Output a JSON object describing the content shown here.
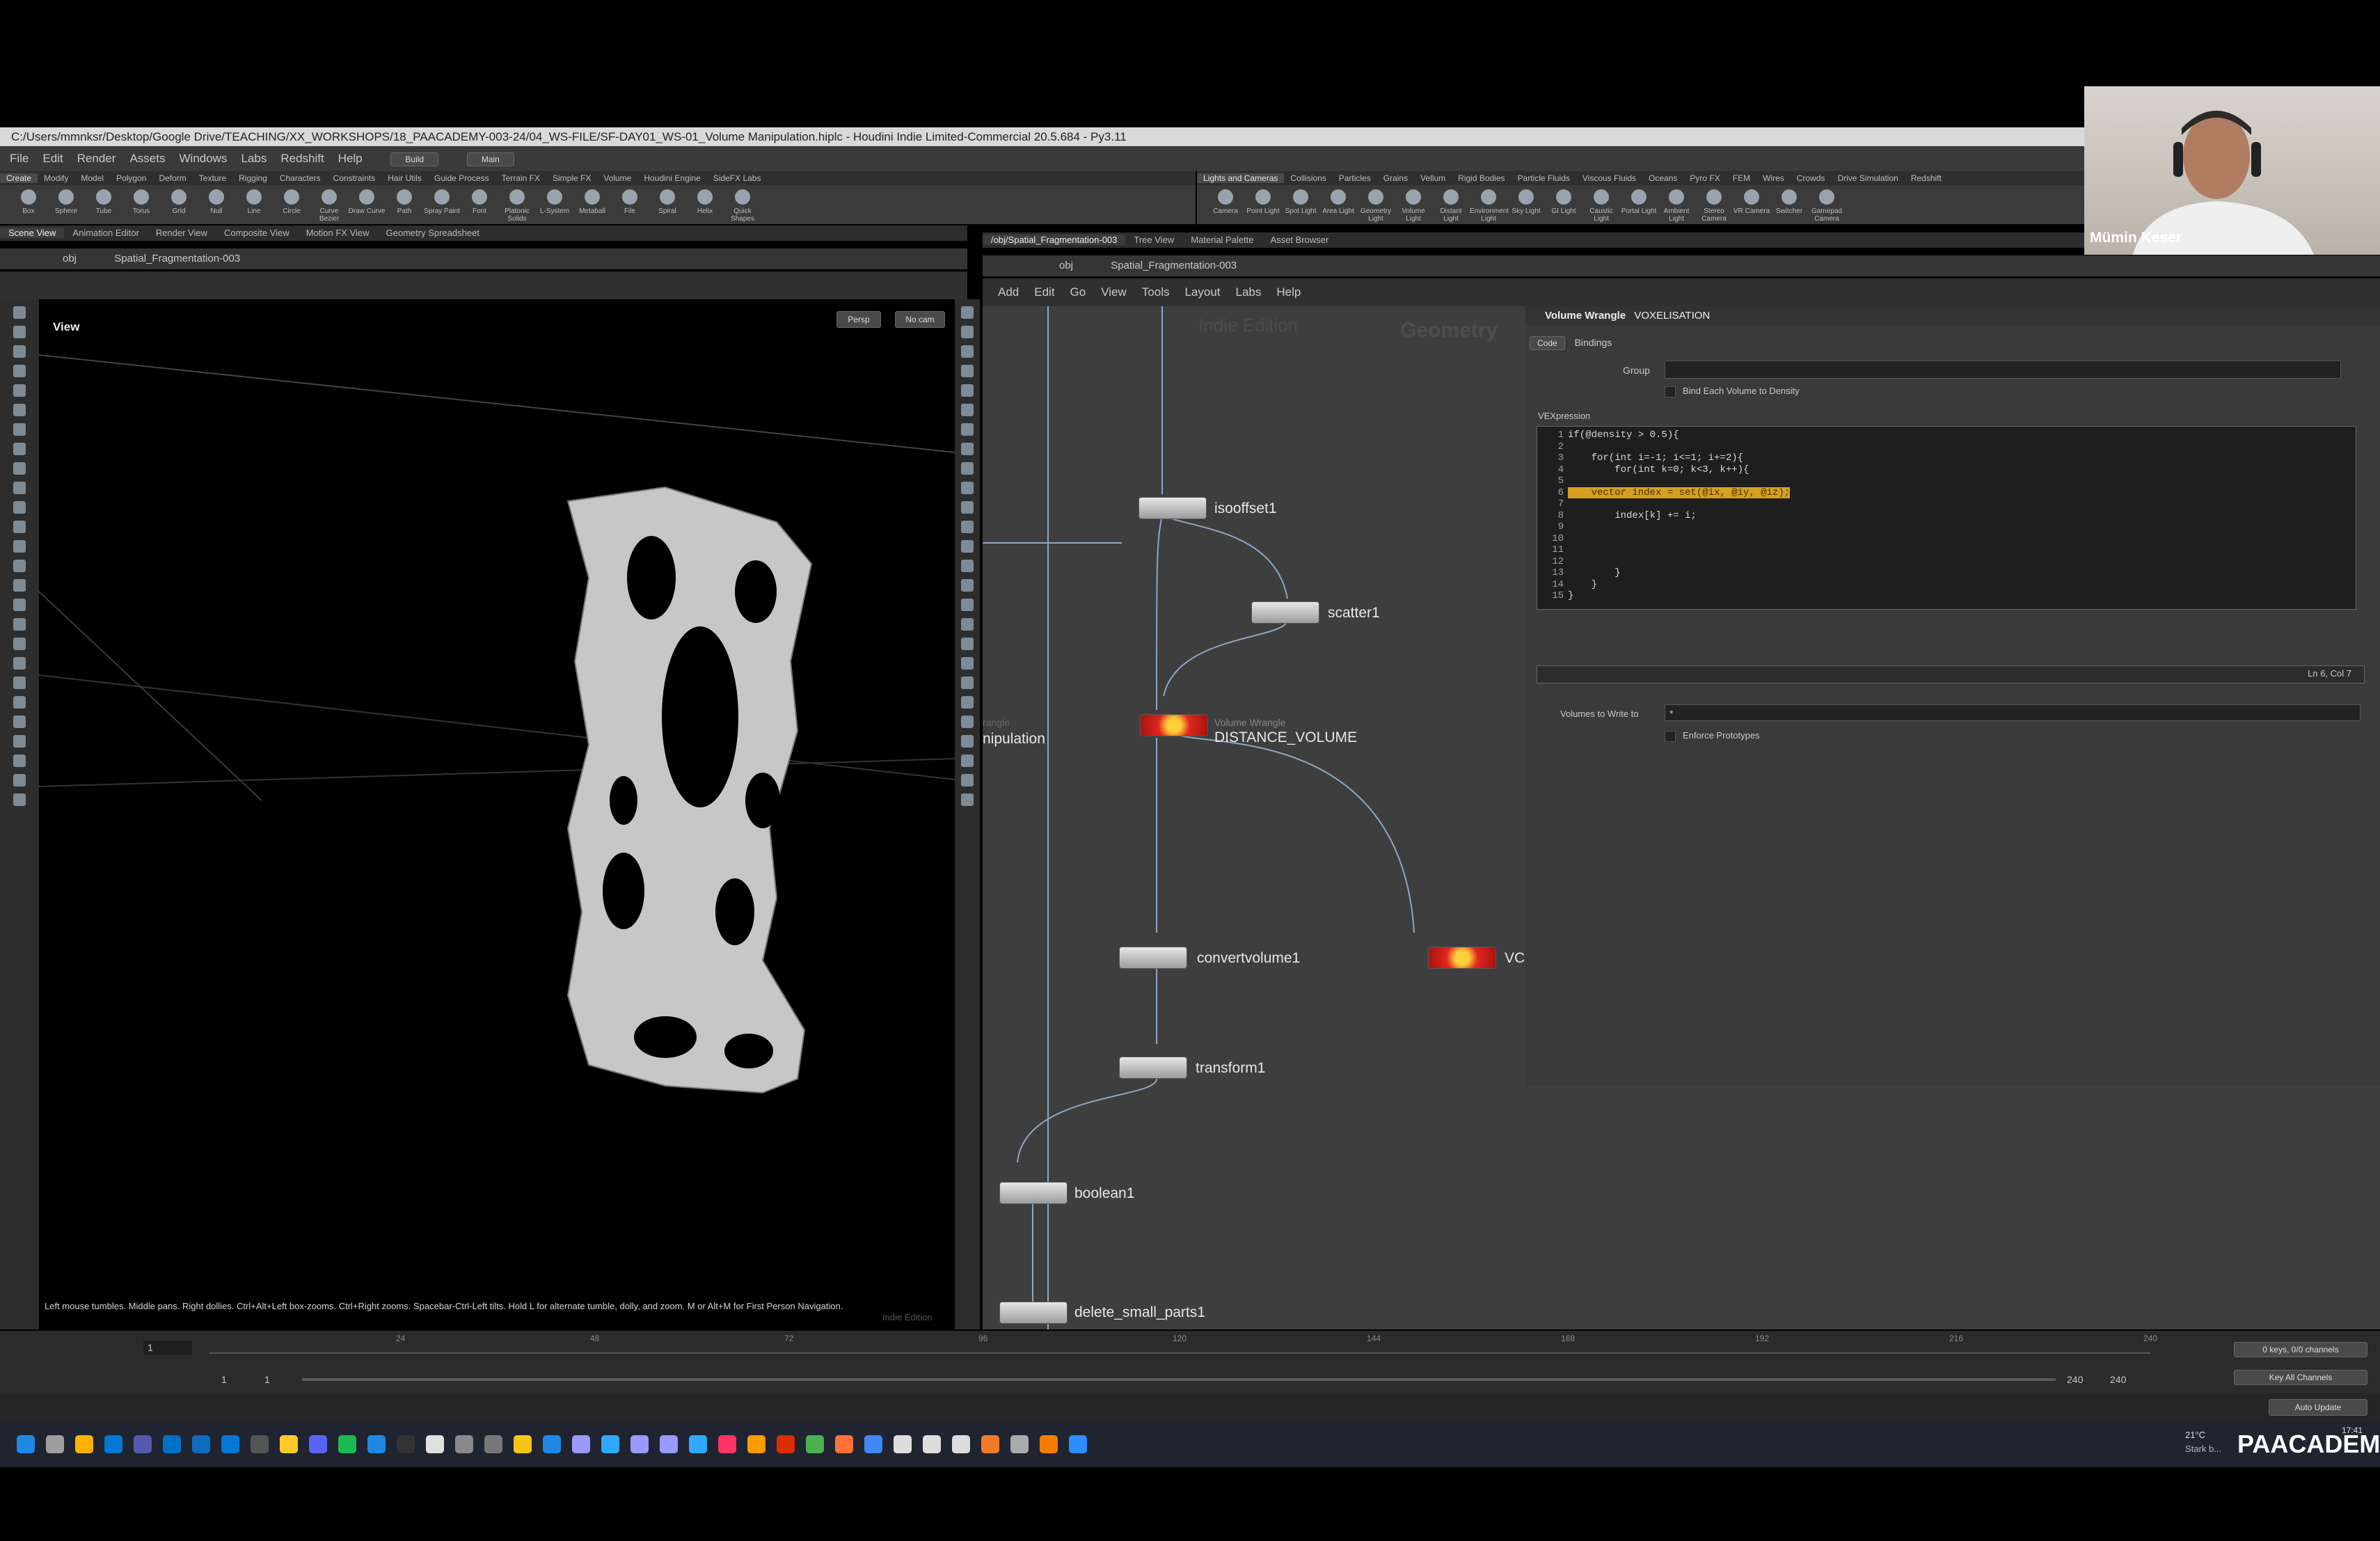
{
  "window": {
    "title": "C:/Users/mmnksr/Desktop/Google Drive/TEACHING/XX_WORKSHOPS/18_PAACADEMY-003-24/04_WS-FILE/SF-DAY01_WS-01_Volume Manipulation.hiplc - Houdini Indie Limited-Commercial 20.5.684 - Py3.11"
  },
  "menu": [
    "File",
    "Edit",
    "Render",
    "Assets",
    "Windows",
    "Labs",
    "Redshift",
    "Help"
  ],
  "desktops": {
    "build": "Build",
    "main": "Main"
  },
  "shelf_left": {
    "tabs": [
      "Create",
      "Modify",
      "Model",
      "Polygon",
      "Deform",
      "Texture",
      "Rigging",
      "Characters",
      "Constraints",
      "Hair Utils",
      "Guide Process",
      "Terrain FX",
      "Simple FX",
      "Volume",
      "Houdini Engine",
      "SideFX Labs"
    ],
    "tools": [
      "Box",
      "Sphere",
      "Tube",
      "Torus",
      "Grid",
      "Null",
      "Line",
      "Circle",
      "Curve Bezier",
      "Draw Curve",
      "Path",
      "Spray Paint",
      "Font",
      "Platonic Solids",
      "L-System",
      "Metaball",
      "File",
      "Spiral",
      "Helix",
      "Quick Shapes"
    ]
  },
  "shelf_right": {
    "tabs": [
      "Lights and Cameras",
      "Collisions",
      "Particles",
      "Grains",
      "Vellum",
      "Rigid Bodies",
      "Particle Fluids",
      "Viscous Fluids",
      "Oceans",
      "Pyro FX",
      "FEM",
      "Wires",
      "Crowds",
      "Drive Simulation",
      "Redshift"
    ],
    "tools": [
      "Camera",
      "Point Light",
      "Spot Light",
      "Area Light",
      "Geometry Light",
      "Volume Light",
      "Distant Light",
      "Environment Light",
      "Sky Light",
      "GI Light",
      "Caustic Light",
      "Portal Light",
      "Ambient Light",
      "Stereo Camera",
      "VR Camera",
      "Switcher",
      "Gamepad Camera"
    ]
  },
  "left_pane": {
    "tabs": [
      "Scene View",
      "Animation Editor",
      "Render View",
      "Composite View",
      "Motion FX View",
      "Geometry Spreadsheet"
    ],
    "path": {
      "context": "obj",
      "node": "Spatial_Fragmentation-003"
    },
    "view_label": "View",
    "persp": "Persp",
    "cam": "No cam",
    "status": "Left mouse tumbles. Middle pans. Right dollies. Ctrl+Alt+Left box-zooms. Ctrl+Right zooms. Spacebar-Ctrl-Left tilts. Hold L for alternate tumble, dolly, and zoom. M or Alt+M for First Person Navigation.",
    "watermark": "Indie Edition"
  },
  "network_pane": {
    "tabs": [
      "/obj/Spatial_Fragmentation-003",
      "Tree View",
      "Material Palette",
      "Asset Browser"
    ],
    "path": {
      "context": "obj",
      "node": "Spatial_Fragmentation-003"
    },
    "menu": [
      "Add",
      "Edit",
      "Go",
      "View",
      "Tools",
      "Layout",
      "Labs",
      "Help"
    ],
    "watermark_edition": "Indie Edition",
    "watermark_context": "Geometry",
    "partial_label_1": "rangle",
    "partial_label_2": "nipulation",
    "nodes": {
      "isooffset": "isooffset1",
      "scatter": "scatter1",
      "distance_type": "Volume Wrangle",
      "distance": "DISTANCE_VOLUME",
      "convert": "convertvolume1",
      "transform": "transform1",
      "boolean": "boolean1",
      "delete": "delete_small_parts1",
      "vox_partial": "VC"
    }
  },
  "param_pane": {
    "node_type": "Volume Wrangle",
    "node_name": "VOXELISATION",
    "tabs": [
      "Code",
      "Bindings"
    ],
    "group_label": "Group",
    "bind_label": "Bind Each Volume to Density",
    "vex_label": "VEXpression",
    "code_lines": [
      {
        "n": "1",
        "t": "if(@density > 0.5){"
      },
      {
        "n": "2",
        "t": ""
      },
      {
        "n": "3",
        "t": "    for(int i=-1; i<=1; i+=2){"
      },
      {
        "n": "4",
        "t": "        for(int k=0; k<3, k++){"
      },
      {
        "n": "5",
        "t": ""
      },
      {
        "n": "6",
        "t": "    vector index = set(@ix, @iy, @iz);"
      },
      {
        "n": "7",
        "t": ""
      },
      {
        "n": "8",
        "t": "        index[k] += i;"
      },
      {
        "n": "9",
        "t": ""
      },
      {
        "n": "10",
        "t": ""
      },
      {
        "n": "11",
        "t": ""
      },
      {
        "n": "12",
        "t": ""
      },
      {
        "n": "13",
        "t": "        }"
      },
      {
        "n": "14",
        "t": "    }"
      },
      {
        "n": "15",
        "t": "}"
      }
    ],
    "cursor_pos": "Ln 6, Col 7",
    "volumes_label": "Volumes to Write to",
    "volumes_value": "*",
    "enforce_label": "Enforce Prototypes"
  },
  "timeline": {
    "frame": "1",
    "ticks": [
      "24",
      "48",
      "72",
      "96",
      "120",
      "144",
      "168",
      "192",
      "216",
      "240"
    ],
    "start": "1",
    "start2": "1",
    "end": "240",
    "end2": "240",
    "keys": "0 keys, 0/0 channels",
    "key_all": "Key All Channels",
    "auto_update": "Auto Update"
  },
  "webcam": {
    "name": "Mümin Keser"
  },
  "taskbar": {
    "weather_temp": "21°C",
    "weather_desc": "Stark b...",
    "brand": "PAACADEMY",
    "clock": "17:41"
  }
}
